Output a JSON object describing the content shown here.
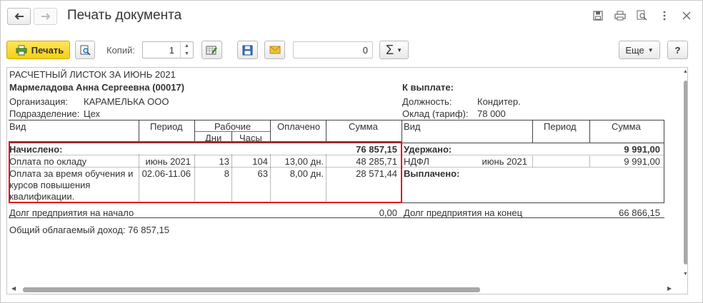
{
  "window": {
    "title": "Печать документа"
  },
  "toolbar": {
    "print_label": "Печать",
    "copies_label": "Копий:",
    "copies_value": "1",
    "sum_value": "0",
    "more_label": "Еще",
    "help_label": "?"
  },
  "document": {
    "heading": "РАСЧЕТНЫЙ ЛИСТОК ЗА ИЮНЬ 2021",
    "employee": "Мармеладова Анна Сергеевна (00017)",
    "to_pay_label": "К выплате:",
    "org_label": "Организация:",
    "org_value": "КАРАМЕЛЬКА ООО",
    "dept_label": "Подразделение:",
    "dept_value": "Цех",
    "position_label": "Должность:",
    "position_value": "Кондитер.",
    "salary_label": "Оклад (тариф):",
    "salary_value": "78 000",
    "left_headers": {
      "kind": "Вид",
      "period": "Период",
      "working": "Рабочие",
      "days": "Дни",
      "hours": "Часы",
      "paid": "Оплачено",
      "sum": "Сумма"
    },
    "right_headers": {
      "kind": "Вид",
      "period": "Период",
      "sum": "Сумма"
    },
    "accrued_label": "Начислено:",
    "accrued_total": "76 857,15",
    "withheld_label": "Удержано:",
    "withheld_total": "9 991,00",
    "accruals": [
      {
        "kind": "Оплата по окладу",
        "period": "июнь 2021",
        "days": "13",
        "hours": "104",
        "paid": "13,00 дн.",
        "sum": "48 285,71"
      },
      {
        "kind_lines": [
          "Оплата за время обучения и",
          "курсов повышения",
          "квалификации."
        ],
        "period": "02.06-11.06",
        "days": "8",
        "hours": "63",
        "paid": "8,00 дн.",
        "sum": "28 571,44"
      }
    ],
    "withholdings": [
      {
        "kind": "НДФЛ",
        "period": "июнь 2021",
        "sum": "9 991,00"
      }
    ],
    "paid_out_label": "Выплачено:",
    "debt_start_label": "Долг предприятия на начало",
    "debt_start_value": "0,00",
    "debt_end_label": "Долг предприятия на конец",
    "debt_end_value": "66 866,15",
    "taxable_income": "Общий облагаемый доход: 76 857,15"
  }
}
